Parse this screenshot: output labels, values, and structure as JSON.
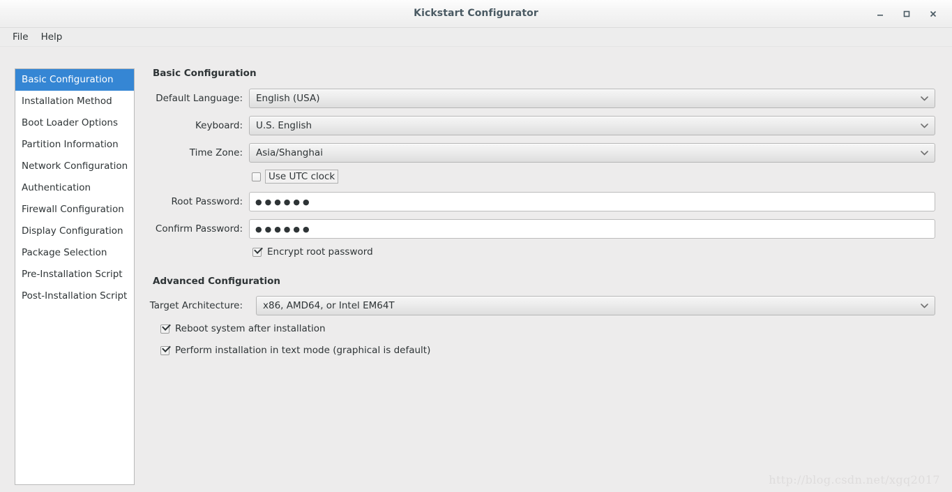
{
  "window": {
    "title": "Kickstart Configurator",
    "controls": [
      {
        "name": "minimize-button",
        "glyph": "minimize"
      },
      {
        "name": "maximize-button",
        "glyph": "maximize"
      },
      {
        "name": "close-button",
        "glyph": "close"
      }
    ]
  },
  "menubar": {
    "items": [
      {
        "label": "File"
      },
      {
        "label": "Help"
      }
    ]
  },
  "sidebar": {
    "selected_index": 0,
    "items": [
      {
        "label": "Basic Configuration"
      },
      {
        "label": "Installation Method"
      },
      {
        "label": "Boot Loader Options"
      },
      {
        "label": "Partition Information"
      },
      {
        "label": "Network Configuration"
      },
      {
        "label": "Authentication"
      },
      {
        "label": "Firewall Configuration"
      },
      {
        "label": "Display Configuration"
      },
      {
        "label": "Package Selection"
      },
      {
        "label": "Pre-Installation Script"
      },
      {
        "label": "Post-Installation Script"
      }
    ]
  },
  "basic_section": {
    "heading": "Basic Configuration",
    "default_language": {
      "label": "Default Language:",
      "value": "English (USA)",
      "icon": "chevron-down-icon"
    },
    "keyboard": {
      "label": "Keyboard:",
      "value": "U.S. English",
      "icon": "chevron-down-icon"
    },
    "time_zone": {
      "label": "Time Zone:",
      "value": "Asia/Shanghai",
      "icon": "chevron-down-icon"
    },
    "use_utc": {
      "label": "Use UTC clock",
      "checked": false,
      "focused": true
    },
    "root_password": {
      "label": "Root Password:",
      "value": "●●●●●●"
    },
    "confirm_password": {
      "label": "Confirm Password:",
      "value": "●●●●●●"
    },
    "encrypt_root_password": {
      "label": "Encrypt root password",
      "checked": true
    }
  },
  "advanced_section": {
    "heading": "Advanced Configuration",
    "target_architecture": {
      "label": "Target Architecture:",
      "value": "x86, AMD64, or Intel EM64T",
      "icon": "chevron-down-icon"
    },
    "reboot_after_install": {
      "label": "Reboot system after installation",
      "checked": true
    },
    "text_mode_install": {
      "label": "Perform installation in text mode (graphical is default)",
      "checked": true
    }
  },
  "watermark": {
    "text": "http://blog.csdn.net/xgq2017"
  },
  "colors": {
    "selection": "#3586d4",
    "window_bg": "#edecec",
    "panel_bg": "#ffffff",
    "text": "#2e3436",
    "title_text": "#4a5a63"
  }
}
